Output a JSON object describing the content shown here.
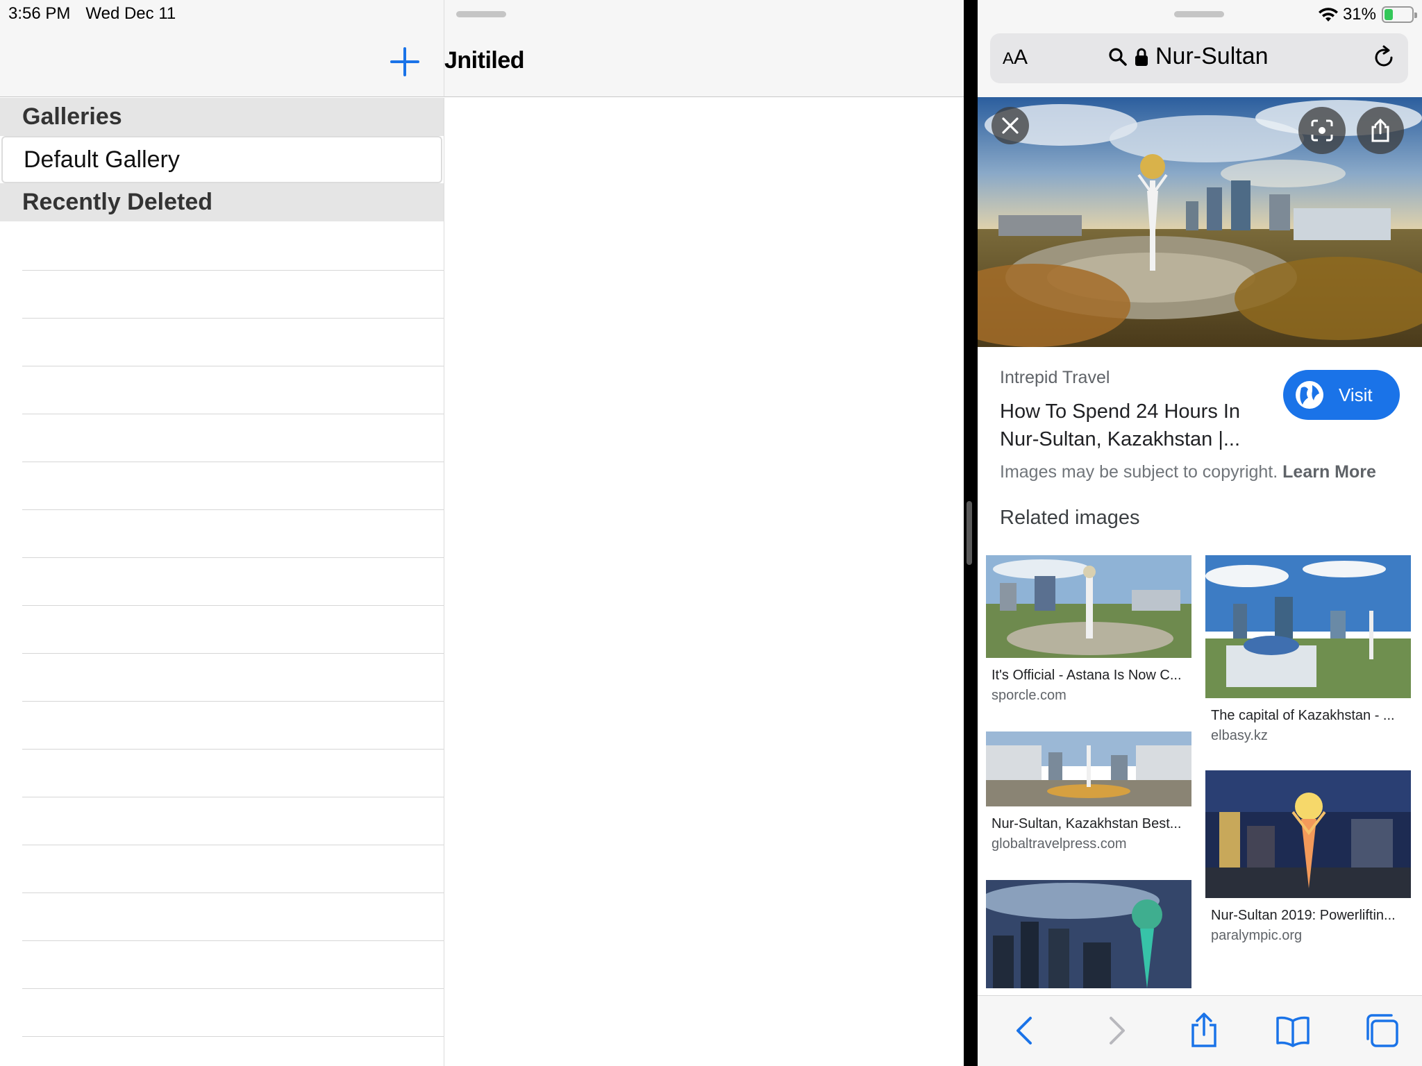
{
  "status_bar": {
    "time": "3:56 PM",
    "date": "Wed Dec 11",
    "battery": "31%",
    "battery_level": 0.31
  },
  "left_app": {
    "detail_title": "Jnitiled",
    "sections": {
      "galleries": "Galleries",
      "default_gallery": "Default Gallery",
      "recently_deleted": "Recently Deleted"
    }
  },
  "safari": {
    "url_bar": {
      "aa_label_small": "A",
      "aa_label_large": "A",
      "query": "Nur-Sultan"
    },
    "result": {
      "source": "Intrepid Travel",
      "title_line1": "How To Spend 24 Hours In",
      "title_line2": "Nur-Sultan, Kazakhstan |...",
      "visit_label": "Visit",
      "copyright_text": "Images may be subject to copyright.",
      "learn_more": "Learn More"
    },
    "related_heading": "Related images",
    "related": [
      {
        "title": "It's Official - Astana Is Now C...",
        "source": "sporcle.com"
      },
      {
        "title": "The capital of Kazakhstan - ...",
        "source": "elbasy.kz"
      },
      {
        "title": "Nur-Sultan, Kazakhstan Best...",
        "source": "globaltravelpress.com"
      },
      {
        "title": "Nur-Sultan 2019: Powerliftin...",
        "source": "paralympic.org"
      },
      {
        "title": "",
        "source": ""
      }
    ]
  },
  "colors": {
    "accent": "#1a73e8",
    "section_bg": "#e5e5e5",
    "nav_bg": "#f6f6f6",
    "battery_green": "#34c759"
  },
  "icons": [
    "plus-icon",
    "wifi-icon",
    "battery-icon",
    "search-icon",
    "lock-icon",
    "reload-icon",
    "close-icon",
    "lens-icon",
    "share-icon",
    "globe-icon",
    "back-icon",
    "forward-icon",
    "bookmarks-icon",
    "tabs-icon"
  ]
}
